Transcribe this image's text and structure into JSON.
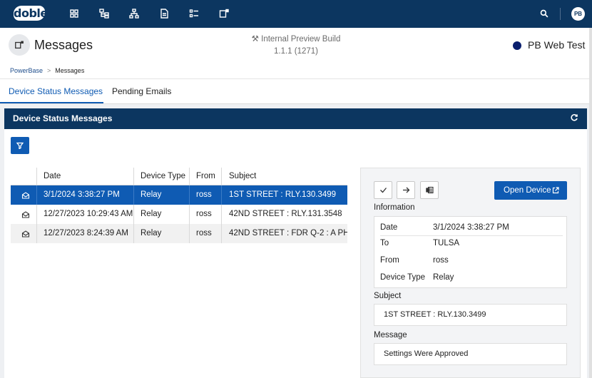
{
  "app": {
    "logo_text": "doble",
    "user_initials": "PB",
    "nav_icons": [
      "dashboard-icon",
      "hierarchy-icon",
      "network-icon",
      "document-icon",
      "list-icon",
      "messages-icon"
    ]
  },
  "header": {
    "title": "Messages",
    "build_label": "Internal Preview Build",
    "build_version": "1.1.1 (1271)",
    "environment": "PB Web Test"
  },
  "breadcrumb": {
    "root": "PowerBase",
    "separator": ">",
    "current": "Messages"
  },
  "tabs": [
    {
      "label": "Device Status Messages",
      "active": true
    },
    {
      "label": "Pending Emails",
      "active": false
    }
  ],
  "panel": {
    "title": "Device Status Messages"
  },
  "table": {
    "columns": [
      "Date",
      "Device Type",
      "From",
      "Subject"
    ],
    "rows": [
      {
        "date": "3/1/2024 3:38:27 PM",
        "device_type": "Relay",
        "from": "ross",
        "subject": "1ST STREET : RLY.130.3499",
        "selected": true
      },
      {
        "date": "12/27/2023 10:29:43 AM",
        "device_type": "Relay",
        "from": "ross",
        "subject": "42ND STREET : RLY.131.3548",
        "selected": false
      },
      {
        "date": "12/27/2023 8:24:39 AM",
        "device_type": "Relay",
        "from": "ross",
        "subject": "42ND STREET : FDR Q-2 : A PH",
        "selected": false
      }
    ]
  },
  "detail": {
    "open_device_label": "Open Device",
    "information_label": "Information",
    "info": [
      {
        "key": "Date",
        "value": "3/1/2024 3:38:27 PM"
      },
      {
        "key": "To",
        "value": "TULSA"
      },
      {
        "key": "From",
        "value": "ross"
      },
      {
        "key": "Device Type",
        "value": "Relay"
      }
    ],
    "subject_label": "Subject",
    "subject_value": "1ST STREET : RLY.130.3499",
    "message_label": "Message",
    "message_value": "Settings Were Approved"
  },
  "colors": {
    "topbar": "#0c3660",
    "accent": "#0f5bb3",
    "selected_row": "#0f5bb3",
    "env_dot": "#0a1f6e"
  }
}
